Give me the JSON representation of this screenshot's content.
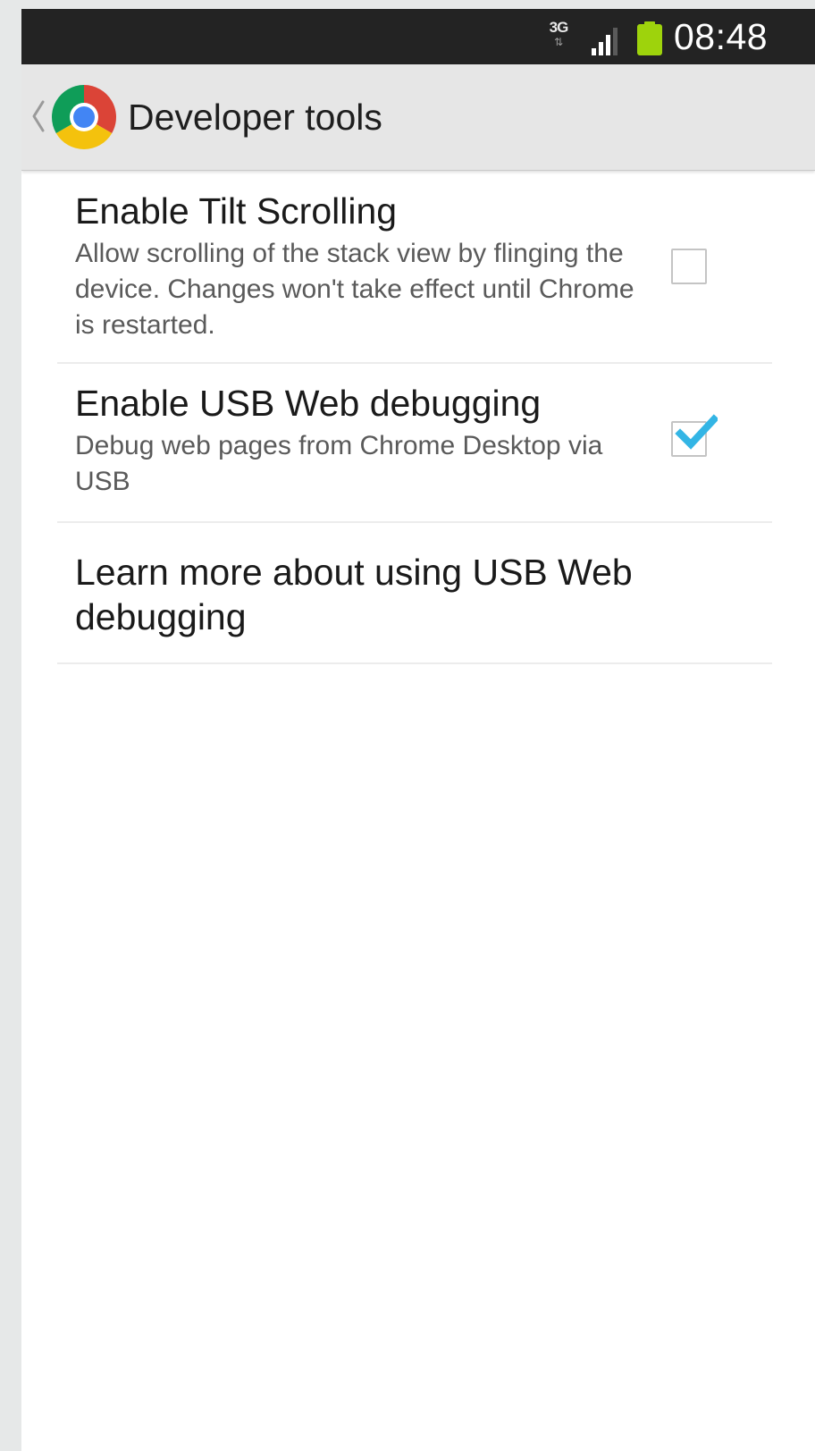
{
  "status_bar": {
    "network_type": "3G",
    "network_arrows": "⇅",
    "time": "08:48",
    "signal_icon": "signal-icon",
    "battery_icon": "battery-icon"
  },
  "action_bar": {
    "up_icon": "chevron-left-icon",
    "app_icon": "chrome-logo-icon",
    "title": "Developer tools"
  },
  "preferences": [
    {
      "title": "Enable Tilt Scrolling",
      "summary": "Allow scrolling of the stack view by flinging the device. Changes won't take effect until Chrome is restarted.",
      "checked": false
    },
    {
      "title": "Enable USB Web debugging",
      "summary": "Debug web pages from Chrome Desktop via USB",
      "checked": true
    },
    {
      "title": "Learn more about using USB Web debugging"
    }
  ],
  "colors": {
    "status_bar_bg": "#232323",
    "action_bar_bg": "#e6e6e6",
    "battery_green": "#9ed30c",
    "check_blue": "#33b5e5"
  }
}
